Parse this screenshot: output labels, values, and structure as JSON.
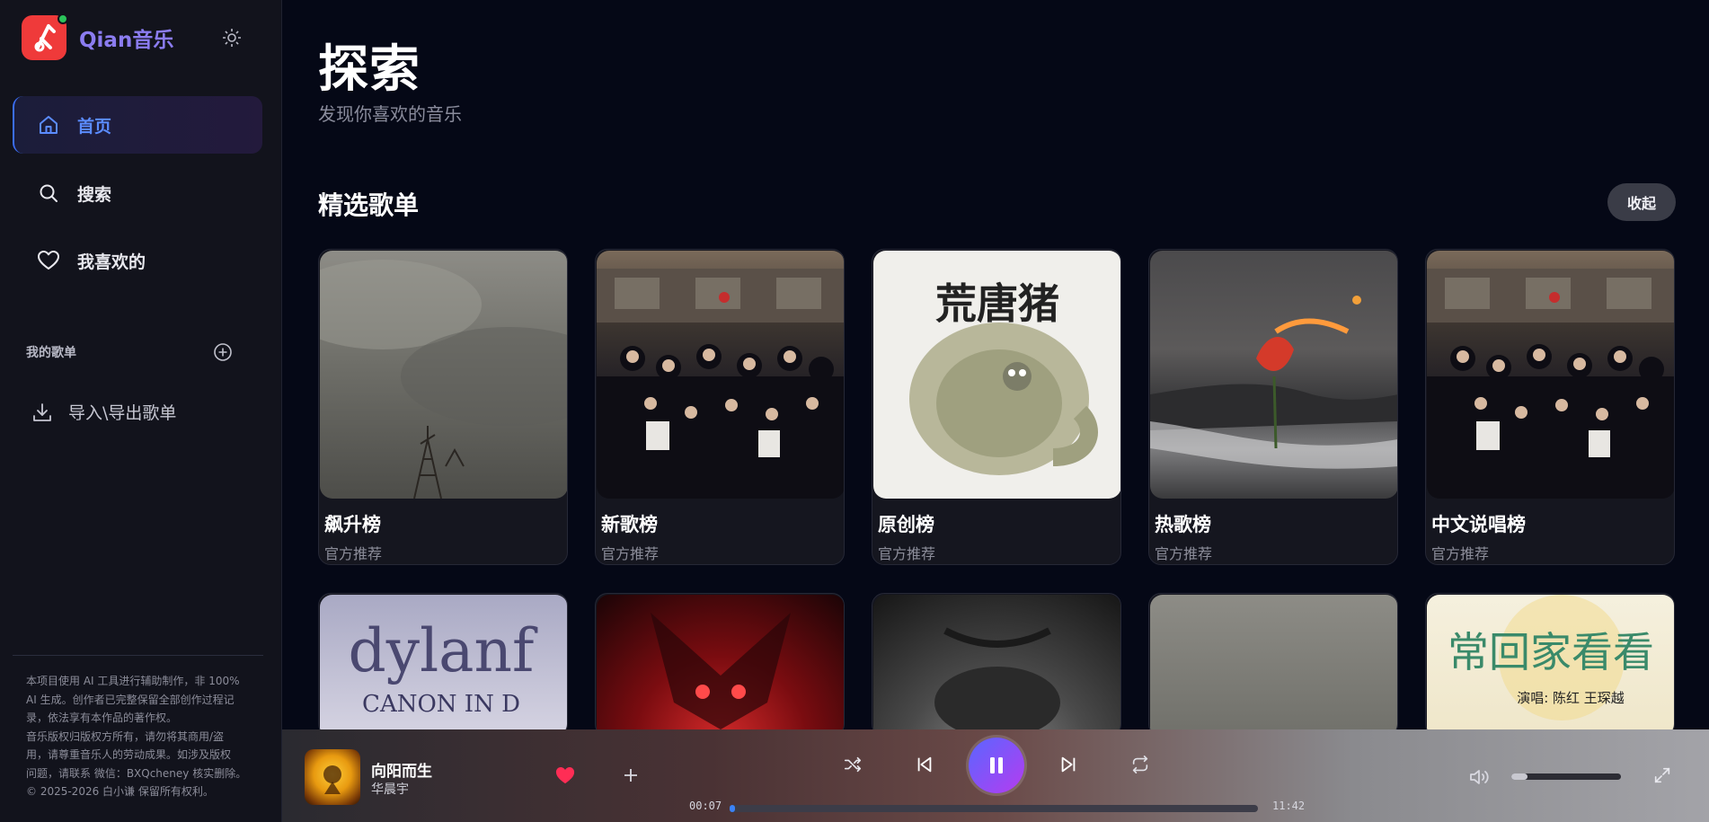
{
  "app": {
    "name": "Qian音乐"
  },
  "nav": {
    "items": [
      {
        "label": "首页",
        "icon": "home-icon",
        "active": true
      },
      {
        "label": "搜索",
        "icon": "search-icon",
        "active": false
      },
      {
        "label": "我喜欢的",
        "icon": "heart-icon",
        "active": false
      }
    ],
    "playlists_label": "我的歌单",
    "import_label": "导入\\导出歌单"
  },
  "footer": {
    "lines": [
      "本项目使用 AI 工具进行辅助制作，非 100%",
      "AI 生成。创作者已完整保留全部创作过程记",
      "录，依法享有本作品的著作权。",
      "音乐版权归版权方所有，请勿将其商用/盗",
      "用，请尊重音乐人的劳动成果。如涉及版权",
      "问题，请联系 微信：BXQcheney 核实删除。",
      "© 2025-2026 白小谦 保留所有权利。"
    ]
  },
  "main": {
    "title": "探索",
    "subtitle": "发现你喜欢的音乐",
    "section_title": "精选歌单",
    "collapse_label": "收起",
    "cards": [
      {
        "title": "飙升榜",
        "subtitle": "官方推荐"
      },
      {
        "title": "新歌榜",
        "subtitle": "官方推荐"
      },
      {
        "title": "原创榜",
        "subtitle": "官方推荐"
      },
      {
        "title": "热歌榜",
        "subtitle": "官方推荐"
      },
      {
        "title": "中文说唱榜",
        "subtitle": "官方推荐"
      }
    ],
    "covers_row2": [
      {
        "text_1": "dylanf",
        "text_2": "CANON IN D"
      },
      {},
      {},
      {},
      {
        "text_1": "常回家看看",
        "text_2": "演唱: 陈红 王琛越"
      }
    ],
    "cover_3_art_text": "荒唐猪"
  },
  "player": {
    "title": "向阳而生",
    "artist": "华晨宇",
    "current_time": "00:07",
    "total_time": "11:42",
    "progress": 0.01,
    "volume": 0.15,
    "liked": true,
    "colors": {
      "accent": "#3b82f6",
      "like": "#ff2d55"
    }
  }
}
